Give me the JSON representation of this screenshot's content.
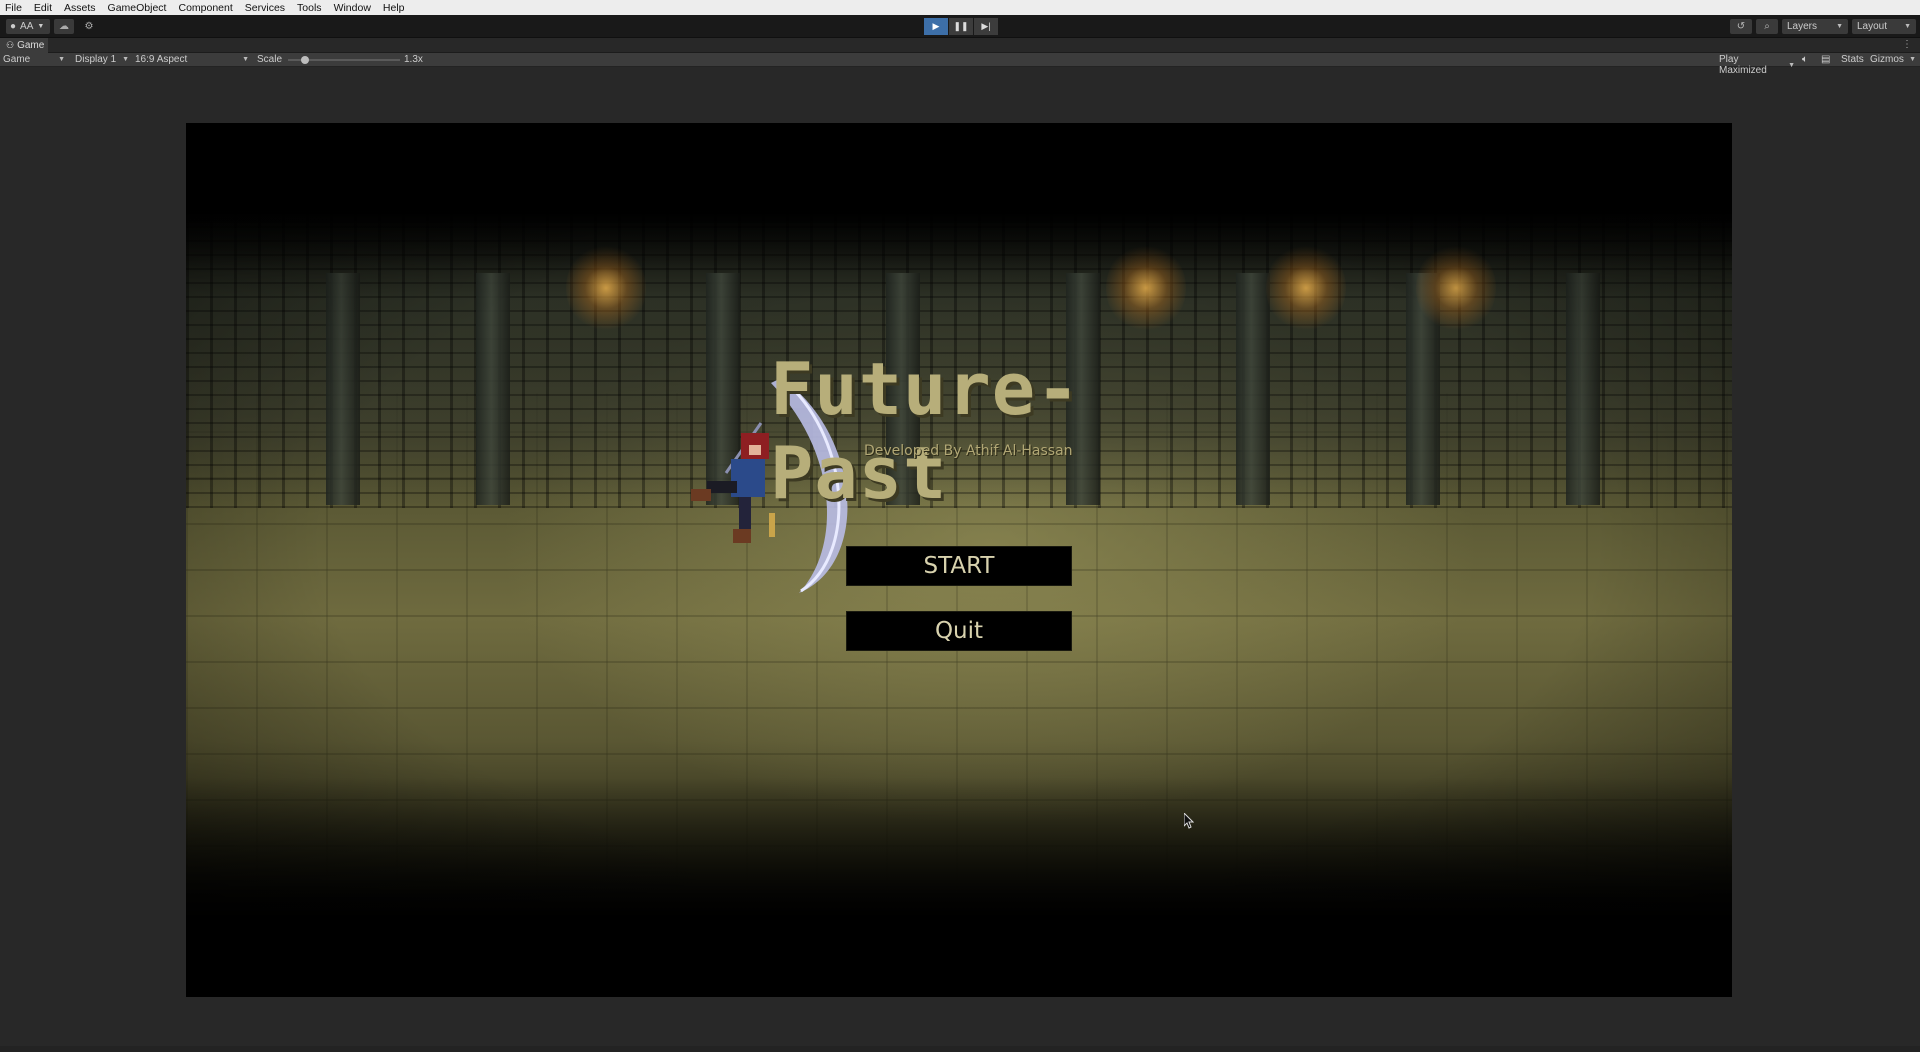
{
  "menu": [
    "File",
    "Edit",
    "Assets",
    "GameObject",
    "Component",
    "Services",
    "Tools",
    "Window",
    "Help"
  ],
  "toolbar": {
    "account_label": "AA",
    "cloud_icon": "cloud-icon",
    "collab_icon": "collab-icon",
    "layers_label": "Layers",
    "layout_label": "Layout"
  },
  "tab": {
    "label": "Game"
  },
  "game_toolbar": {
    "view_select": "Game",
    "display_select": "Display 1",
    "aspect_select": "16:9 Aspect",
    "scale_label": "Scale",
    "scale_value": "1.3x",
    "scale_fraction": 0.1,
    "play_mode_select": "Play Maximized",
    "stats_label": "Stats",
    "gizmos_label": "Gizmos"
  },
  "game": {
    "title": "Future-Past",
    "subtitle": "Developed By Athif Al-Hassan",
    "start_label": "START",
    "quit_label": "Quit"
  },
  "colors": {
    "accent_play": "#3d6fa8",
    "title_text": "#b7ae7a",
    "button_bg": "#000000"
  }
}
